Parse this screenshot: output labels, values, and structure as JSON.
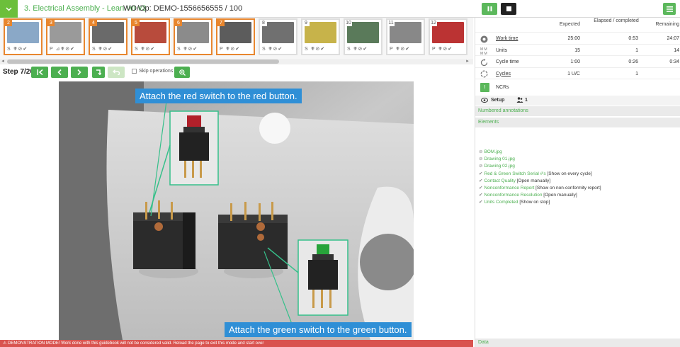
{
  "header": {
    "guide_title": "3. Electrical Assembly - Lean WI v3",
    "wo_op": "WO/Op: DEMO-1556656555 / 100"
  },
  "thumbnails": [
    {
      "num": "2",
      "tags": "S ✟⊘✔",
      "done": true
    },
    {
      "num": "3",
      "tags": "P ⊿✟⊘✔",
      "done": true
    },
    {
      "num": "4",
      "tags": "S ✟⊘✔",
      "done": true
    },
    {
      "num": "5",
      "tags": "S ✟⊘✔",
      "done": true
    },
    {
      "num": "6",
      "tags": "S ✟⊘✔",
      "done": true
    },
    {
      "num": "7",
      "tags": "P ✟⊘✔",
      "done": true
    },
    {
      "num": "8",
      "tags": "S ✟⊘✔",
      "done": false
    },
    {
      "num": "9",
      "tags": "S ✟⊘✔",
      "done": false
    },
    {
      "num": "10",
      "tags": "S ✟⊘✔",
      "done": false
    },
    {
      "num": "11",
      "tags": "P ✟⊘✔",
      "done": false
    },
    {
      "num": "12",
      "tags": "P ✟⊘✔",
      "done": false
    }
  ],
  "step": {
    "prefix": "Step ",
    "current": "7/20",
    "skip_label": "Skip operations"
  },
  "photo": {
    "callout_top": "Attach the red switch to the red button.",
    "callout_bottom": "Attach the green switch to the green button."
  },
  "notice": "⚠ DEMONSTRATION MODE! Work done with this guidebook will not be considered valid. Reload the page to exit this mode and start over",
  "stats": {
    "headers": {
      "expected": "Expected",
      "elapsed": "Elapsed / completed",
      "remaining": "Remaining"
    },
    "rows": [
      {
        "label": "Work time",
        "underline": true,
        "expected": "25:00",
        "elapsed": "0:53",
        "remaining": "24:07"
      },
      {
        "label": "Units",
        "underline": false,
        "expected": "15",
        "elapsed": "1",
        "remaining": "14"
      },
      {
        "label": "Cycle time",
        "underline": false,
        "expected": "1:00",
        "elapsed": "0:26",
        "remaining": "0:34"
      },
      {
        "label": "Cycles",
        "underline": true,
        "expected": "1 U/C",
        "elapsed": "1",
        "remaining": ""
      }
    ],
    "ncr_label": "NCRs"
  },
  "setup": {
    "label": "Setup",
    "count": "1"
  },
  "sections": {
    "annotations": "Numbered annotations",
    "elements": "Elements",
    "data": "Data"
  },
  "elements": [
    {
      "icon": "link",
      "text": "BOM.jpg",
      "suffix": ""
    },
    {
      "icon": "link",
      "text": "Drawing 01.jpg",
      "suffix": ""
    },
    {
      "icon": "link",
      "text": "Drawing 02.jpg",
      "suffix": ""
    },
    {
      "icon": "check",
      "text": "Red & Green Switch Serial #'s",
      "suffix": " [Show on every cycle]"
    },
    {
      "icon": "check",
      "text": "Contact Quality",
      "suffix": " [Open manually]"
    },
    {
      "icon": "check",
      "text": "Nonconformance Report",
      "suffix": " [Show on non-conformity report]"
    },
    {
      "icon": "check",
      "text": "Nonconformance Resolution",
      "suffix": " [Open manually]"
    },
    {
      "icon": "check",
      "text": "Units Completed",
      "suffix": " [Show on stop]"
    }
  ]
}
